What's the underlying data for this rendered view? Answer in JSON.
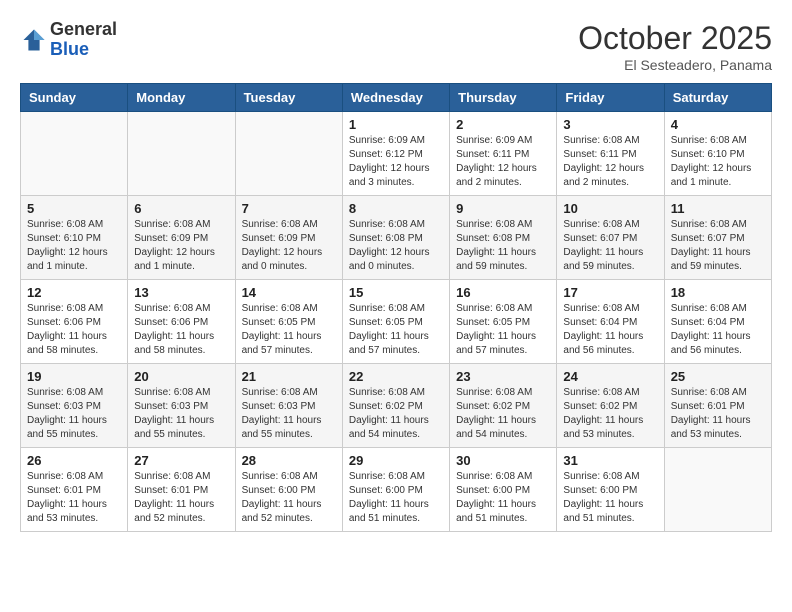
{
  "header": {
    "logo_line1": "General",
    "logo_line2": "Blue",
    "month": "October 2025",
    "location": "El Sesteadero, Panama"
  },
  "days_of_week": [
    "Sunday",
    "Monday",
    "Tuesday",
    "Wednesday",
    "Thursday",
    "Friday",
    "Saturday"
  ],
  "weeks": [
    [
      {
        "day": "",
        "info": ""
      },
      {
        "day": "",
        "info": ""
      },
      {
        "day": "",
        "info": ""
      },
      {
        "day": "1",
        "info": "Sunrise: 6:09 AM\nSunset: 6:12 PM\nDaylight: 12 hours and 3 minutes."
      },
      {
        "day": "2",
        "info": "Sunrise: 6:09 AM\nSunset: 6:11 PM\nDaylight: 12 hours and 2 minutes."
      },
      {
        "day": "3",
        "info": "Sunrise: 6:08 AM\nSunset: 6:11 PM\nDaylight: 12 hours and 2 minutes."
      },
      {
        "day": "4",
        "info": "Sunrise: 6:08 AM\nSunset: 6:10 PM\nDaylight: 12 hours and 1 minute."
      }
    ],
    [
      {
        "day": "5",
        "info": "Sunrise: 6:08 AM\nSunset: 6:10 PM\nDaylight: 12 hours and 1 minute."
      },
      {
        "day": "6",
        "info": "Sunrise: 6:08 AM\nSunset: 6:09 PM\nDaylight: 12 hours and 1 minute."
      },
      {
        "day": "7",
        "info": "Sunrise: 6:08 AM\nSunset: 6:09 PM\nDaylight: 12 hours and 0 minutes."
      },
      {
        "day": "8",
        "info": "Sunrise: 6:08 AM\nSunset: 6:08 PM\nDaylight: 12 hours and 0 minutes."
      },
      {
        "day": "9",
        "info": "Sunrise: 6:08 AM\nSunset: 6:08 PM\nDaylight: 11 hours and 59 minutes."
      },
      {
        "day": "10",
        "info": "Sunrise: 6:08 AM\nSunset: 6:07 PM\nDaylight: 11 hours and 59 minutes."
      },
      {
        "day": "11",
        "info": "Sunrise: 6:08 AM\nSunset: 6:07 PM\nDaylight: 11 hours and 59 minutes."
      }
    ],
    [
      {
        "day": "12",
        "info": "Sunrise: 6:08 AM\nSunset: 6:06 PM\nDaylight: 11 hours and 58 minutes."
      },
      {
        "day": "13",
        "info": "Sunrise: 6:08 AM\nSunset: 6:06 PM\nDaylight: 11 hours and 58 minutes."
      },
      {
        "day": "14",
        "info": "Sunrise: 6:08 AM\nSunset: 6:05 PM\nDaylight: 11 hours and 57 minutes."
      },
      {
        "day": "15",
        "info": "Sunrise: 6:08 AM\nSunset: 6:05 PM\nDaylight: 11 hours and 57 minutes."
      },
      {
        "day": "16",
        "info": "Sunrise: 6:08 AM\nSunset: 6:05 PM\nDaylight: 11 hours and 57 minutes."
      },
      {
        "day": "17",
        "info": "Sunrise: 6:08 AM\nSunset: 6:04 PM\nDaylight: 11 hours and 56 minutes."
      },
      {
        "day": "18",
        "info": "Sunrise: 6:08 AM\nSunset: 6:04 PM\nDaylight: 11 hours and 56 minutes."
      }
    ],
    [
      {
        "day": "19",
        "info": "Sunrise: 6:08 AM\nSunset: 6:03 PM\nDaylight: 11 hours and 55 minutes."
      },
      {
        "day": "20",
        "info": "Sunrise: 6:08 AM\nSunset: 6:03 PM\nDaylight: 11 hours and 55 minutes."
      },
      {
        "day": "21",
        "info": "Sunrise: 6:08 AM\nSunset: 6:03 PM\nDaylight: 11 hours and 55 minutes."
      },
      {
        "day": "22",
        "info": "Sunrise: 6:08 AM\nSunset: 6:02 PM\nDaylight: 11 hours and 54 minutes."
      },
      {
        "day": "23",
        "info": "Sunrise: 6:08 AM\nSunset: 6:02 PM\nDaylight: 11 hours and 54 minutes."
      },
      {
        "day": "24",
        "info": "Sunrise: 6:08 AM\nSunset: 6:02 PM\nDaylight: 11 hours and 53 minutes."
      },
      {
        "day": "25",
        "info": "Sunrise: 6:08 AM\nSunset: 6:01 PM\nDaylight: 11 hours and 53 minutes."
      }
    ],
    [
      {
        "day": "26",
        "info": "Sunrise: 6:08 AM\nSunset: 6:01 PM\nDaylight: 11 hours and 53 minutes."
      },
      {
        "day": "27",
        "info": "Sunrise: 6:08 AM\nSunset: 6:01 PM\nDaylight: 11 hours and 52 minutes."
      },
      {
        "day": "28",
        "info": "Sunrise: 6:08 AM\nSunset: 6:00 PM\nDaylight: 11 hours and 52 minutes."
      },
      {
        "day": "29",
        "info": "Sunrise: 6:08 AM\nSunset: 6:00 PM\nDaylight: 11 hours and 51 minutes."
      },
      {
        "day": "30",
        "info": "Sunrise: 6:08 AM\nSunset: 6:00 PM\nDaylight: 11 hours and 51 minutes."
      },
      {
        "day": "31",
        "info": "Sunrise: 6:08 AM\nSunset: 6:00 PM\nDaylight: 11 hours and 51 minutes."
      },
      {
        "day": "",
        "info": ""
      }
    ]
  ]
}
